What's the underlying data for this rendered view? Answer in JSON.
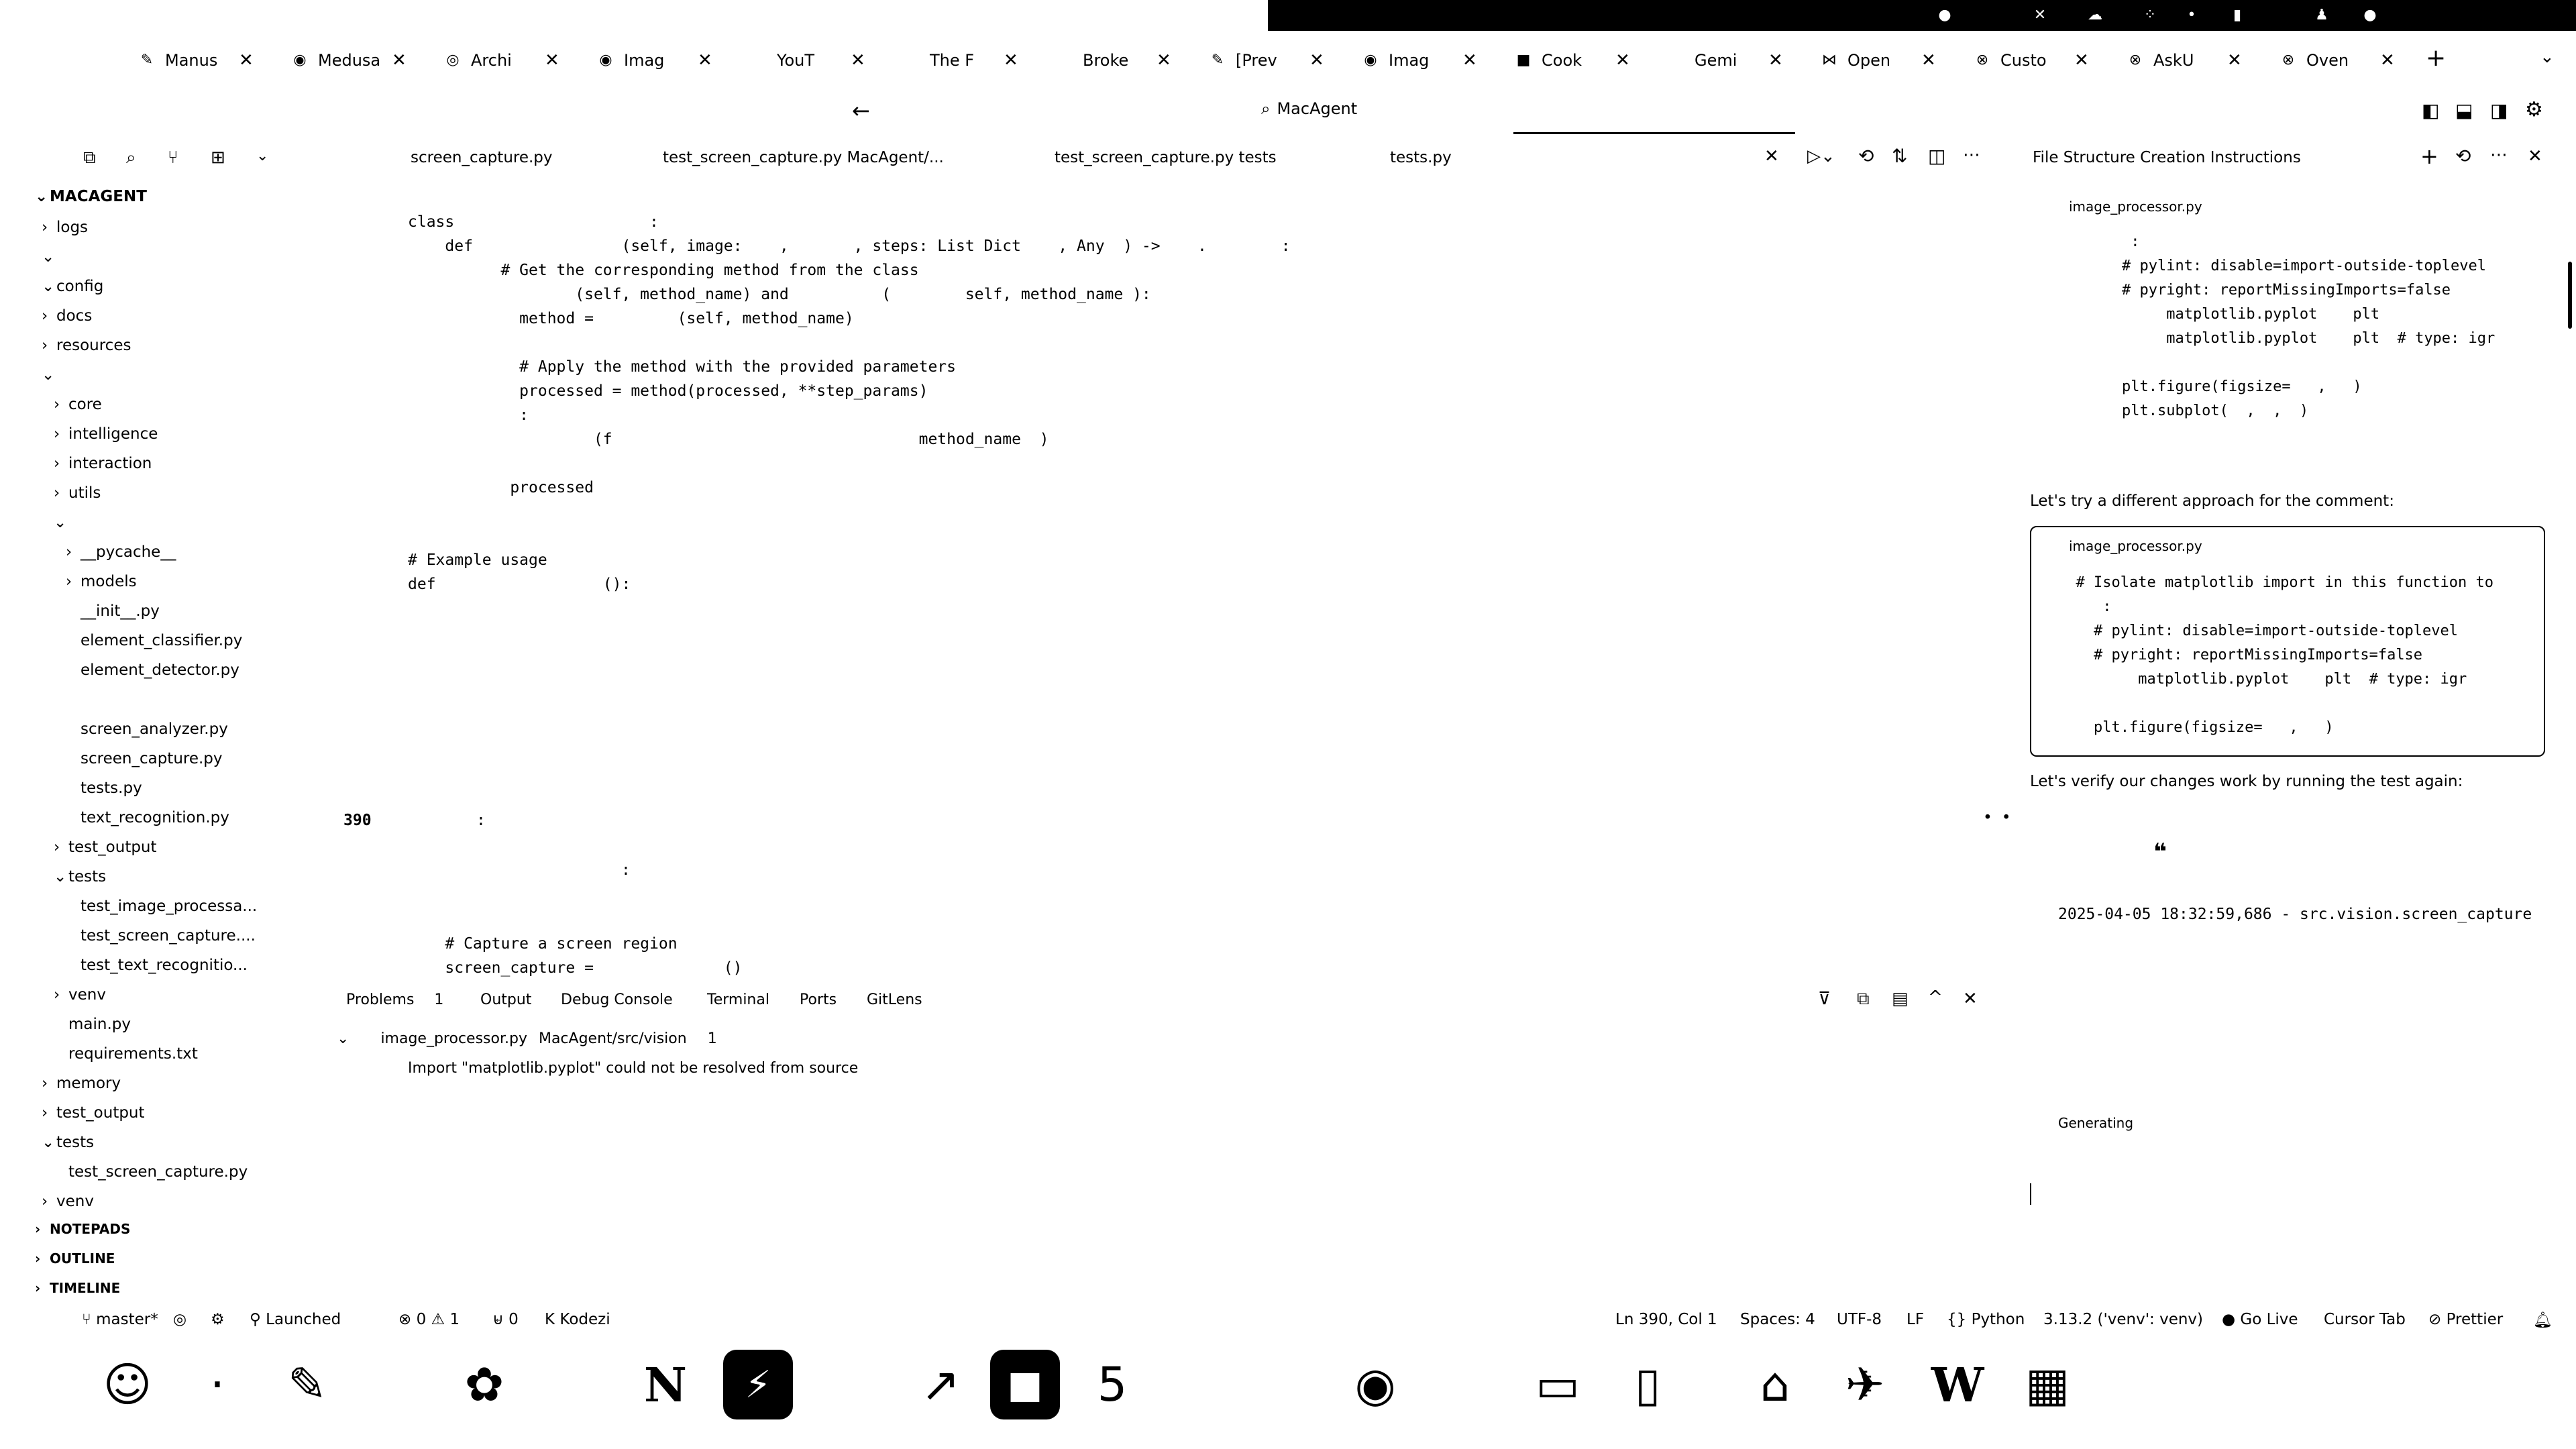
{
  "tabs": [
    {
      "label": "Manus",
      "icon": "pen-icon"
    },
    {
      "label": "Medusa",
      "icon": "github-icon"
    },
    {
      "label": "Archi",
      "icon": "circle-icon"
    },
    {
      "label": "Imag",
      "icon": "github-icon"
    },
    {
      "label": "YouT",
      "icon": "youtube-icon"
    },
    {
      "label": "The F",
      "icon": "page-icon"
    },
    {
      "label": "Broke",
      "icon": "page-icon"
    },
    {
      "label": "[Prev",
      "icon": "pen-icon"
    },
    {
      "label": "Imag",
      "icon": "github-icon"
    },
    {
      "label": "Cook",
      "icon": "square-icon"
    },
    {
      "label": "Gemi",
      "icon": "gemini-icon"
    },
    {
      "label": "Open",
      "icon": "bowtie-icon"
    },
    {
      "label": "Custo",
      "icon": "openai-icon"
    },
    {
      "label": "AskU",
      "icon": "openai-icon"
    },
    {
      "label": "Oven",
      "icon": "openai-icon"
    }
  ],
  "new_tab": "+",
  "address": {
    "text": "MacAgent"
  },
  "editor_tabs": [
    {
      "label": "screen_capture.py"
    },
    {
      "label": "test_screen_capture.py MacAgent/..."
    },
    {
      "label": "test_screen_capture.py tests"
    },
    {
      "label": "tests.py"
    }
  ],
  "explorer": {
    "root": "MACAGENT",
    "items": [
      {
        "label": "logs",
        "chev": ">",
        "indent": 1
      },
      {
        "label": "",
        "chev": "v",
        "indent": 1
      },
      {
        "label": "config",
        "chev": "v",
        "indent": 1
      },
      {
        "label": "docs",
        "chev": ">",
        "indent": 1
      },
      {
        "label": "resources",
        "chev": ">",
        "indent": 1
      },
      {
        "label": "",
        "chev": "v",
        "indent": 1
      },
      {
        "label": "core",
        "chev": ">",
        "indent": 2
      },
      {
        "label": "intelligence",
        "chev": ">",
        "indent": 2
      },
      {
        "label": "interaction",
        "chev": ">",
        "indent": 2
      },
      {
        "label": "utils",
        "chev": ">",
        "indent": 2
      },
      {
        "label": "",
        "chev": "v",
        "indent": 2
      },
      {
        "label": "__pycache__",
        "chev": ">",
        "indent": 3
      },
      {
        "label": "models",
        "chev": ">",
        "indent": 3
      },
      {
        "label": "__init__.py",
        "chev": "",
        "indent": 3
      },
      {
        "label": "element_classifier.py",
        "chev": "",
        "indent": 3
      },
      {
        "label": "element_detector.py",
        "chev": "",
        "indent": 3
      },
      {
        "label": "",
        "chev": "",
        "indent": 3
      },
      {
        "label": "screen_analyzer.py",
        "chev": "",
        "indent": 3
      },
      {
        "label": "screen_capture.py",
        "chev": "",
        "indent": 3
      },
      {
        "label": "tests.py",
        "chev": "",
        "indent": 3
      },
      {
        "label": "text_recognition.py",
        "chev": "",
        "indent": 3
      },
      {
        "label": "test_output",
        "chev": ">",
        "indent": 2
      },
      {
        "label": "tests",
        "chev": "v",
        "indent": 2
      },
      {
        "label": "test_image_processa...",
        "chev": "",
        "indent": 3
      },
      {
        "label": "test_screen_capture....",
        "chev": "",
        "indent": 3
      },
      {
        "label": "test_text_recognitio...",
        "chev": "",
        "indent": 3
      },
      {
        "label": "venv",
        "chev": ">",
        "indent": 2
      },
      {
        "label": "main.py",
        "chev": "",
        "indent": 2
      },
      {
        "label": "requirements.txt",
        "chev": "",
        "indent": 2
      },
      {
        "label": "memory",
        "chev": ">",
        "indent": 1
      },
      {
        "label": "test_output",
        "chev": ">",
        "indent": 1
      },
      {
        "label": "tests",
        "chev": "v",
        "indent": 1
      },
      {
        "label": "test_screen_capture.py",
        "chev": "",
        "indent": 2
      },
      {
        "label": "venv",
        "chev": ">",
        "indent": 1
      }
    ],
    "sections": [
      "NOTEPADS",
      "OUTLINE",
      "TIMELINE"
    ]
  },
  "code": {
    "lines": [
      {
        "text": "class                     :",
        "indent": 0
      },
      {
        "text": "    def                (self, image:    ,       , steps: List Dict    , Any  ) ->    .        :",
        "indent": 0
      },
      {
        "text": "          # Get the corresponding method from the class",
        "indent": 0
      },
      {
        "text": "                  (self, method_name) and          (        self, method_name ):",
        "indent": 0
      },
      {
        "text": "            method =         (self, method_name)",
        "indent": 0
      },
      {
        "text": "",
        "indent": 0
      },
      {
        "text": "            # Apply the method with the provided parameters",
        "indent": 0
      },
      {
        "text": "            processed = method(processed, **step_params)",
        "indent": 0
      },
      {
        "text": "            :",
        "indent": 0
      },
      {
        "text": "                    (f                                 method_name  )",
        "indent": 0
      },
      {
        "text": "",
        "indent": 0
      },
      {
        "text": "           processed",
        "indent": 0
      },
      {
        "text": "",
        "indent": 0
      },
      {
        "text": "",
        "indent": 0
      },
      {
        "text": "# Example usage",
        "indent": 0
      },
      {
        "text": "def                  ():",
        "indent": 0
      }
    ],
    "line_number": "390",
    "lower_lines": [
      "    # Capture a screen region",
      "    screen_capture =              ()"
    ]
  },
  "panel_tabs": [
    {
      "label": "Problems",
      "badge": "1"
    },
    {
      "label": "Output"
    },
    {
      "label": "Debug Console"
    },
    {
      "label": "Terminal"
    },
    {
      "label": "Ports"
    },
    {
      "label": "GitLens"
    }
  ],
  "problem": {
    "file": "image_processor.py",
    "path": "MacAgent/src/vision",
    "count": "1",
    "message": "Import \"matplotlib.pyplot\" could not be resolved from source"
  },
  "chat": {
    "title": "File Structure Creation Instructions",
    "block1_file": "image_processor.py",
    "block1_lines": [
      "     :",
      "    # pylint: disable=import-outside-toplevel",
      "    # pyright: reportMissingImports=false",
      "         matplotlib.pyplot    plt",
      "         matplotlib.pyplot    plt  # type: igr",
      "",
      "    plt.figure(figsize=   ,   )",
      "    plt.subplot(  ,  ,  )"
    ],
    "msg1": "Let's try a different approach for the comment:",
    "block2_file": "image_processor.py",
    "block2_lines": [
      "  # Isolate matplotlib import in this function to",
      "     :",
      "    # pylint: disable=import-outside-toplevel",
      "    # pyright: reportMissingImports=false",
      "         matplotlib.pyplot    plt  # type: igr",
      "",
      "    plt.figure(figsize=   ,   )"
    ],
    "msg2": "Let's verify our changes work by running the test again:",
    "quote_mark": "❝",
    "log": "2025-04-05 18:32:59,686 - src.vision.screen_capture",
    "generating": "Generating"
  },
  "status": {
    "branch": "master*",
    "launched": "Launched",
    "errors": "0",
    "warnings": "1",
    "ports": "0",
    "kodezi": "Kodezi",
    "ln_col": "Ln 390, Col 1",
    "spaces": "Spaces: 4",
    "encoding": "UTF-8",
    "eol": "LF",
    "language": "Python",
    "interpreter": "3.13.2 ('venv': venv)",
    "golive": "Go Live",
    "cursor_tab": "Cursor Tab",
    "prettier": "Prettier"
  },
  "dock": {
    "apps": [
      {
        "name": "finder-icon",
        "glyph": "☺"
      },
      {
        "name": "app2-icon",
        "glyph": "·"
      },
      {
        "name": "pen-app-icon",
        "glyph": "✎"
      },
      {
        "name": "chatgpt-icon",
        "glyph": "✿"
      },
      {
        "name": "notion-icon",
        "glyph": "N"
      },
      {
        "name": "app-icon-6",
        "glyph": "⚡"
      },
      {
        "name": "cursor-icon",
        "glyph": "↗"
      },
      {
        "name": "terminal-icon",
        "glyph": "■"
      },
      {
        "name": "app-5-icon",
        "glyph": "5"
      },
      {
        "name": "chrome-icon",
        "glyph": "◉"
      },
      {
        "name": "app-11-icon",
        "glyph": "▭"
      },
      {
        "name": "iphone-mirroring-icon",
        "glyph": "▯"
      },
      {
        "name": "app-13-icon",
        "glyph": "⌂"
      },
      {
        "name": "app-14-icon",
        "glyph": "✈"
      },
      {
        "name": "word-icon",
        "glyph": "W"
      },
      {
        "name": "calculator-icon",
        "glyph": "▦"
      }
    ]
  }
}
